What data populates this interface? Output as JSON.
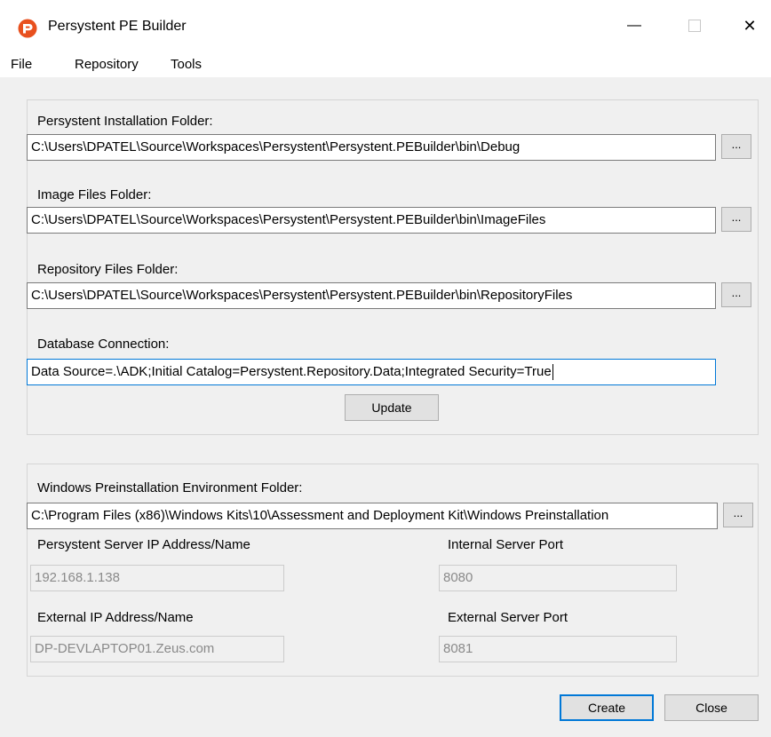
{
  "window": {
    "title": "Persystent PE Builder",
    "minimize_glyph": "—",
    "close_glyph": "✕",
    "accent_color": "#0078d7",
    "icon_color": "#e8501e"
  },
  "menu": {
    "items": [
      "File",
      "Repository",
      "Tools"
    ]
  },
  "paths_group": {
    "install_label": "Persystent Installation Folder:",
    "install_value": "C:\\Users\\DPATEL\\Source\\Workspaces\\Persystent\\Persystent.PEBuilder\\bin\\Debug",
    "image_label": "Image Files Folder:",
    "image_value": "C:\\Users\\DPATEL\\Source\\Workspaces\\Persystent\\Persystent.PEBuilder\\bin\\ImageFiles",
    "repo_label": "Repository Files Folder:",
    "repo_value": "C:\\Users\\DPATEL\\Source\\Workspaces\\Persystent\\Persystent.PEBuilder\\bin\\RepositoryFiles",
    "db_label": "Database Connection:",
    "db_value": "Data Source=.\\ADK;Initial Catalog=Persystent.Repository.Data;Integrated Security=True",
    "browse_label": "...",
    "update_label": "Update"
  },
  "pe_group": {
    "winpe_label": "Windows Preinstallation Environment Folder:",
    "winpe_value": "C:\\Program Files (x86)\\Windows Kits\\10\\Assessment and Deployment Kit\\Windows Preinstallation",
    "browse_label": "...",
    "server_label": "Persystent Server IP Address/Name",
    "server_value": "192.168.1.138",
    "internal_port_label": "Internal Server Port",
    "internal_port_value": "8080",
    "external_label": "External IP Address/Name",
    "external_value": "DP-DEVLAPTOP01.Zeus.com",
    "external_port_label": "External Server Port",
    "external_port_value": "8081"
  },
  "footer": {
    "create_label": "Create",
    "close_label": "Close"
  }
}
